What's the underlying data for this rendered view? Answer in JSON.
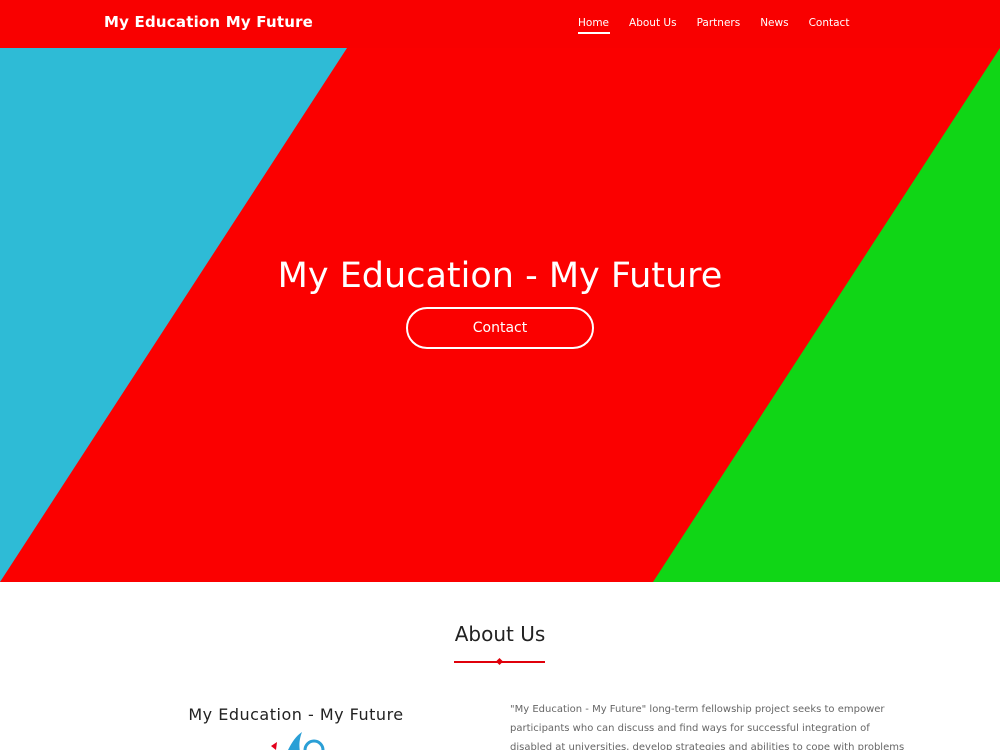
{
  "header": {
    "brand": "My Education My Future",
    "nav": [
      {
        "label": "Home",
        "active": true
      },
      {
        "label": "About Us",
        "active": false
      },
      {
        "label": "Partners",
        "active": false
      },
      {
        "label": "News",
        "active": false
      },
      {
        "label": "Contact",
        "active": false
      }
    ]
  },
  "hero": {
    "title": "My Education - My Future",
    "button_label": "Contact"
  },
  "about": {
    "title": "About Us",
    "subtitle": "My Education - My Future",
    "text": "\"My Education - My Future\" long-term fellowship project seeks to empower participants who can discuss and find ways for successful integration of disabled at universities, develop strategies and abilities to cope with problems"
  },
  "colors": {
    "header_red": "#f90000",
    "hero_red": "#fb0000",
    "hero_blue": "#2ebbd6",
    "hero_green": "#10d616",
    "accent_red": "#e0000b"
  }
}
